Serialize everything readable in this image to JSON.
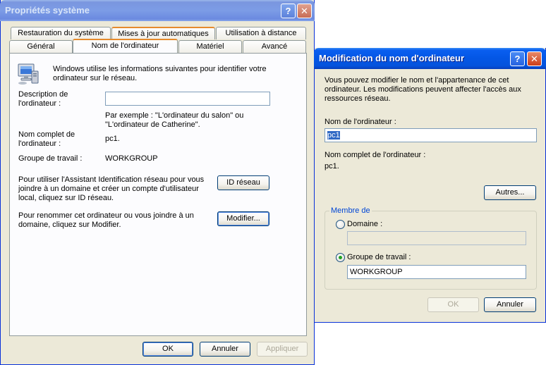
{
  "sysprops": {
    "title": "Propriétés système",
    "tabs_row1": [
      "Restauration du système",
      "Mises à jour automatiques",
      "Utilisation à distance"
    ],
    "tabs_row2": [
      "Général",
      "Nom de l'ordinateur",
      "Matériel",
      "Avancé"
    ],
    "selected_tab": "Nom de l'ordinateur",
    "intro_line1": "Windows utilise les informations suivantes pour identifier votre",
    "intro_line2": "ordinateur sur le réseau.",
    "desc_label_line1": "Description de",
    "desc_label_line2": "l'ordinateur :",
    "desc_value": "",
    "example_line1": "Par exemple : \"L'ordinateur du salon\" ou",
    "example_line2": "\"L'ordinateur de Catherine\".",
    "fullname_label_line1": "Nom complet de",
    "fullname_label_line2": "l'ordinateur :",
    "fullname_value": "pc1.",
    "workgroup_label": "Groupe de travail :",
    "workgroup_value": "WORKGROUP",
    "netid_text_line1": "Pour utiliser l'Assistant Identification réseau pour vous",
    "netid_text_line2": "joindre à un domaine et créer un compte d'utilisateur",
    "netid_text_line3": "local, cliquez sur ID réseau.",
    "netid_button": "ID réseau",
    "rename_text_line1": "Pour renommer cet ordinateur ou vous joindre à un",
    "rename_text_line2": "domaine, cliquez sur Modifier.",
    "modify_button": "Modifier...",
    "ok_button": "OK",
    "cancel_button": "Annuler",
    "apply_button": "Appliquer"
  },
  "rename_dialog": {
    "title": "Modification du nom d'ordinateur",
    "intro_line1": "Vous pouvez modifier le nom et l'appartenance de cet",
    "intro_line2": "ordinateur. Les modifications peuvent affecter l'accès aux",
    "intro_line3": "ressources réseau.",
    "name_label": "Nom de l'ordinateur :",
    "name_value": "pc1",
    "fullname_label": "Nom complet de l'ordinateur :",
    "fullname_value": "pc1.",
    "more_button": "Autres...",
    "member_group": "Membre de",
    "domain_label": "Domaine :",
    "domain_value": "",
    "workgroup_label": "Groupe de travail :",
    "workgroup_value": "WORKGROUP",
    "selected_membership": "workgroup",
    "ok_button": "OK",
    "cancel_button": "Annuler"
  },
  "colors": {
    "title_active": "#0453dd",
    "title_inactive": "#7c9ce6",
    "window_bg": "#ece9d8",
    "tab_highlight": "#e68b2c",
    "selection": "#316ac5",
    "group_legend": "#0046d5"
  },
  "icons": {
    "computer": "computer-icon",
    "help": "help-icon",
    "close": "close-icon"
  }
}
